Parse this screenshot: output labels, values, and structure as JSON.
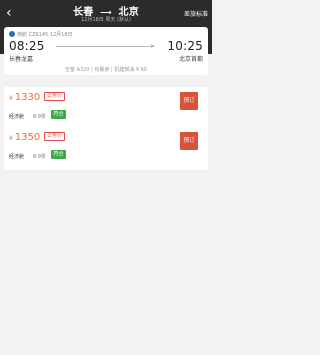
{
  "header": {
    "back_glyph": "‹",
    "origin": "长春",
    "arrow": "⟶",
    "destination": "北京",
    "subtitle": "12月18日 周天 (默认)",
    "rules_link": "差旅标准"
  },
  "flight": {
    "airline_info": "南航 CZ6145 12月18日",
    "dep_time": "08:25",
    "arr_time": "10:25",
    "dep_airport": "长春龙嘉",
    "arr_airport": "北京首都",
    "meta": "空客 A320  |  有餐食  |  机建燃油 ¥ 60"
  },
  "fares": [
    {
      "currency": "¥",
      "price": "1330",
      "tag": "公务行",
      "cabin": "经济舱",
      "discount": "8.9折",
      "rule_label": "符合",
      "book_label": "预订"
    },
    {
      "currency": "¥",
      "price": "1350",
      "tag": "公务行",
      "cabin": "经济舱",
      "discount": "8.9折",
      "rule_label": "符合",
      "book_label": "预订"
    }
  ],
  "colors": {
    "header_bg": "#2b2b2b",
    "price": "#ef6b32",
    "book_button": "#d9533a",
    "rule_badge": "#3fa84e",
    "airline_icon": "#2f6db6"
  }
}
